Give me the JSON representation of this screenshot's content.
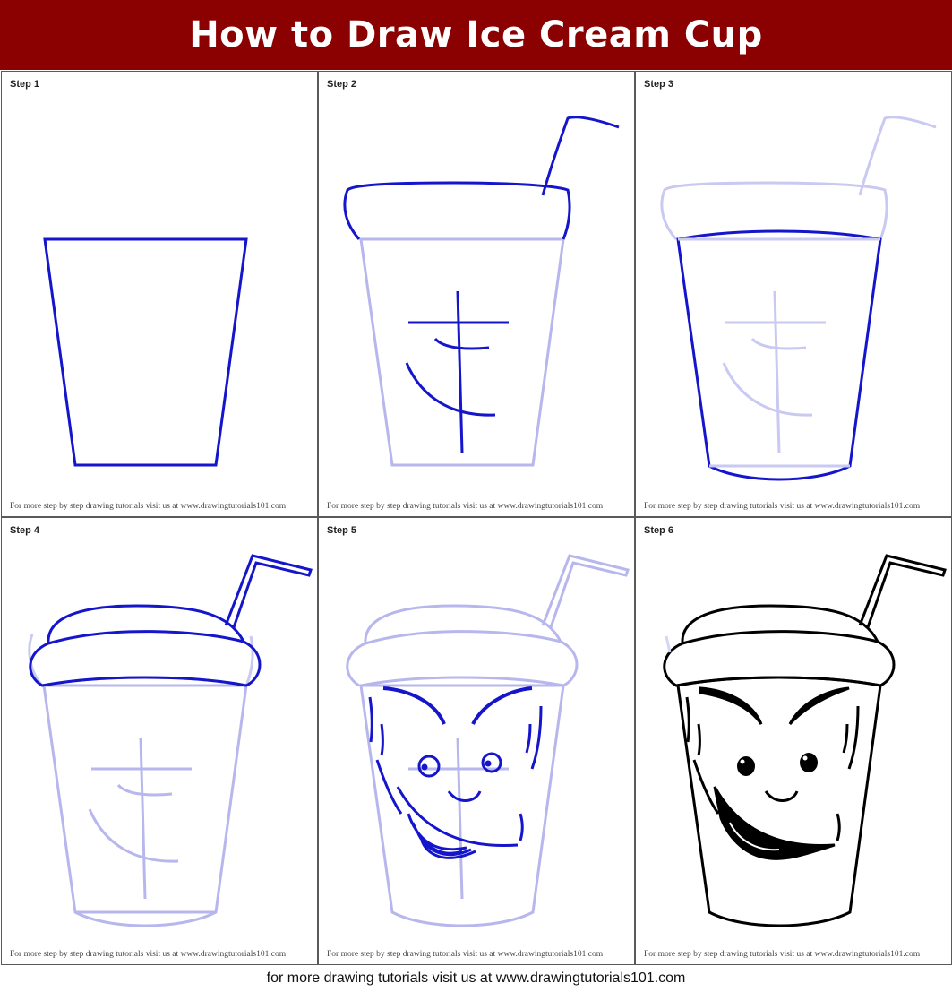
{
  "title": "How to Draw Ice Cream Cup",
  "footer": "for more drawing tutorials visit us at www.drawingtutorials101.com",
  "colors": {
    "header_bg": "#8b0000",
    "new_stroke": "#1515cc",
    "guide_stroke": "#b7b7ee",
    "final_stroke": "#000000"
  },
  "panels": [
    {
      "label": "Step 1",
      "credit": "For more step by step drawing tutorials visit us at www.drawingtutorials101.com"
    },
    {
      "label": "Step 2",
      "credit": "For more step by step drawing tutorials visit us at www.drawingtutorials101.com"
    },
    {
      "label": "Step 3",
      "credit": "For more step by step drawing tutorials visit us at www.drawingtutorials101.com"
    },
    {
      "label": "Step 4",
      "credit": "For more step by step drawing tutorials visit us at www.drawingtutorials101.com"
    },
    {
      "label": "Step 5",
      "credit": "For more step by step drawing tutorials visit us at www.drawingtutorials101.com"
    },
    {
      "label": "Step 6",
      "credit": "For more step by step drawing tutorials visit us at www.drawingtutorials101.com"
    }
  ]
}
